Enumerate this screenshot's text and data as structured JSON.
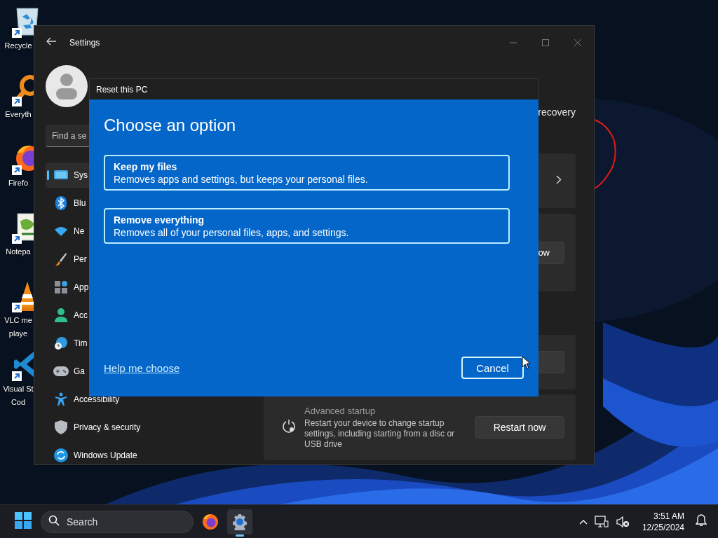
{
  "desktop_icons": [
    {
      "kind": "recycle-bin",
      "lines": [
        "Recycle"
      ]
    },
    {
      "kind": "magnifier",
      "lines": [
        "Everyth"
      ]
    },
    {
      "kind": "browser",
      "lines": [
        "Firefo"
      ]
    },
    {
      "kind": "notepad",
      "lines": [
        "Notepa"
      ]
    },
    {
      "kind": "cone",
      "lines": [
        "VLC me",
        "playe"
      ]
    },
    {
      "kind": "code-editor",
      "lines": [
        "Visual St",
        "Cod"
      ]
    }
  ],
  "settings": {
    "title": "Settings",
    "search": {
      "placeholder": "Find a se"
    },
    "nav": [
      {
        "kind": "system",
        "label": "Sys",
        "selected": true
      },
      {
        "kind": "bluetooth",
        "label": "Blu",
        "selected": false
      },
      {
        "kind": "network",
        "label": "Ne",
        "selected": false
      },
      {
        "kind": "brush",
        "label": "Per",
        "selected": false
      },
      {
        "kind": "apps",
        "label": "App",
        "selected": false
      },
      {
        "kind": "accounts",
        "label": "Acc",
        "selected": false
      },
      {
        "kind": "time",
        "label": "Tim",
        "selected": false
      },
      {
        "kind": "gaming",
        "label": "Ga",
        "selected": false
      },
      {
        "kind": "accessibility",
        "label": "Accessibility",
        "selected": false
      },
      {
        "kind": "privacy",
        "label": "Privacy & security",
        "selected": false
      },
      {
        "kind": "update",
        "label": "Windows Update",
        "selected": false
      }
    ],
    "intro": "recovery",
    "cards": [
      {
        "kind": "link"
      },
      {
        "kind": "button",
        "button": "ow"
      },
      {
        "kind": "blank-button"
      },
      {
        "kind": "action",
        "title": "Advanced startup",
        "description": "Restart your device to change startup settings, including starting from a disc or USB drive",
        "button": "Restart now"
      }
    ]
  },
  "dialog": {
    "title": "Reset this PC",
    "heading": "Choose an option",
    "options": [
      {
        "title": "Keep my files",
        "description": "Removes apps and settings, but keeps your personal files."
      },
      {
        "title": "Remove everything",
        "description": "Removes all of your personal files, apps, and settings."
      }
    ],
    "link": "Help me choose",
    "button": "Cancel"
  },
  "taskbar": {
    "search": {
      "placeholder": "Search"
    },
    "apps": [
      {
        "kind": "browser",
        "active": false
      },
      {
        "kind": "settings",
        "active": true
      }
    ],
    "time": "3:51 AM",
    "date": "12/25/2024"
  }
}
